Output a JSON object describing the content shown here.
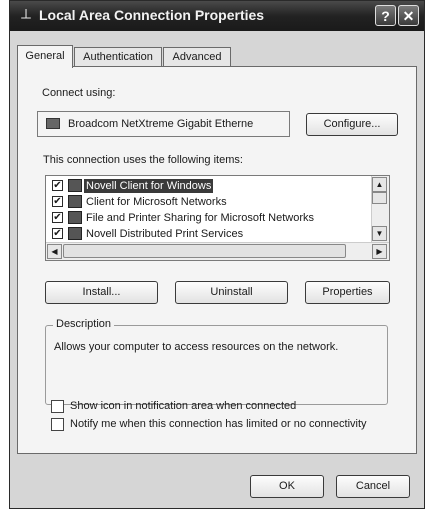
{
  "window": {
    "title": "Local Area Connection Properties",
    "help_label": "?",
    "close_label": "✕"
  },
  "tabs": [
    {
      "label": "General",
      "active": true
    },
    {
      "label": "Authentication",
      "active": false
    },
    {
      "label": "Advanced",
      "active": false
    }
  ],
  "connect": {
    "label": "Connect using:",
    "adapter": "Broadcom NetXtreme Gigabit Etherne",
    "configure_label": "Configure..."
  },
  "items": {
    "label": "This connection uses the following items:",
    "list": [
      {
        "label": "Novell Client for Windows",
        "checked": true,
        "selected": true
      },
      {
        "label": "Client for Microsoft Networks",
        "checked": true,
        "selected": false
      },
      {
        "label": "File and Printer Sharing for Microsoft Networks",
        "checked": true,
        "selected": false
      },
      {
        "label": "Novell Distributed Print Services",
        "checked": true,
        "selected": false
      }
    ]
  },
  "buttons": {
    "install": "Install...",
    "uninstall": "Uninstall",
    "properties": "Properties",
    "ok": "OK",
    "cancel": "Cancel"
  },
  "description": {
    "title": "Description",
    "text": "Allows your computer to access resources on the network."
  },
  "options": {
    "show_icon": "Show icon in notification area when connected",
    "notify": "Notify me when this connection has limited or no connectivity"
  },
  "icons": {
    "title": "network-connection-icon",
    "adapter": "network-adapter-icon",
    "item": "network-component-icon"
  }
}
